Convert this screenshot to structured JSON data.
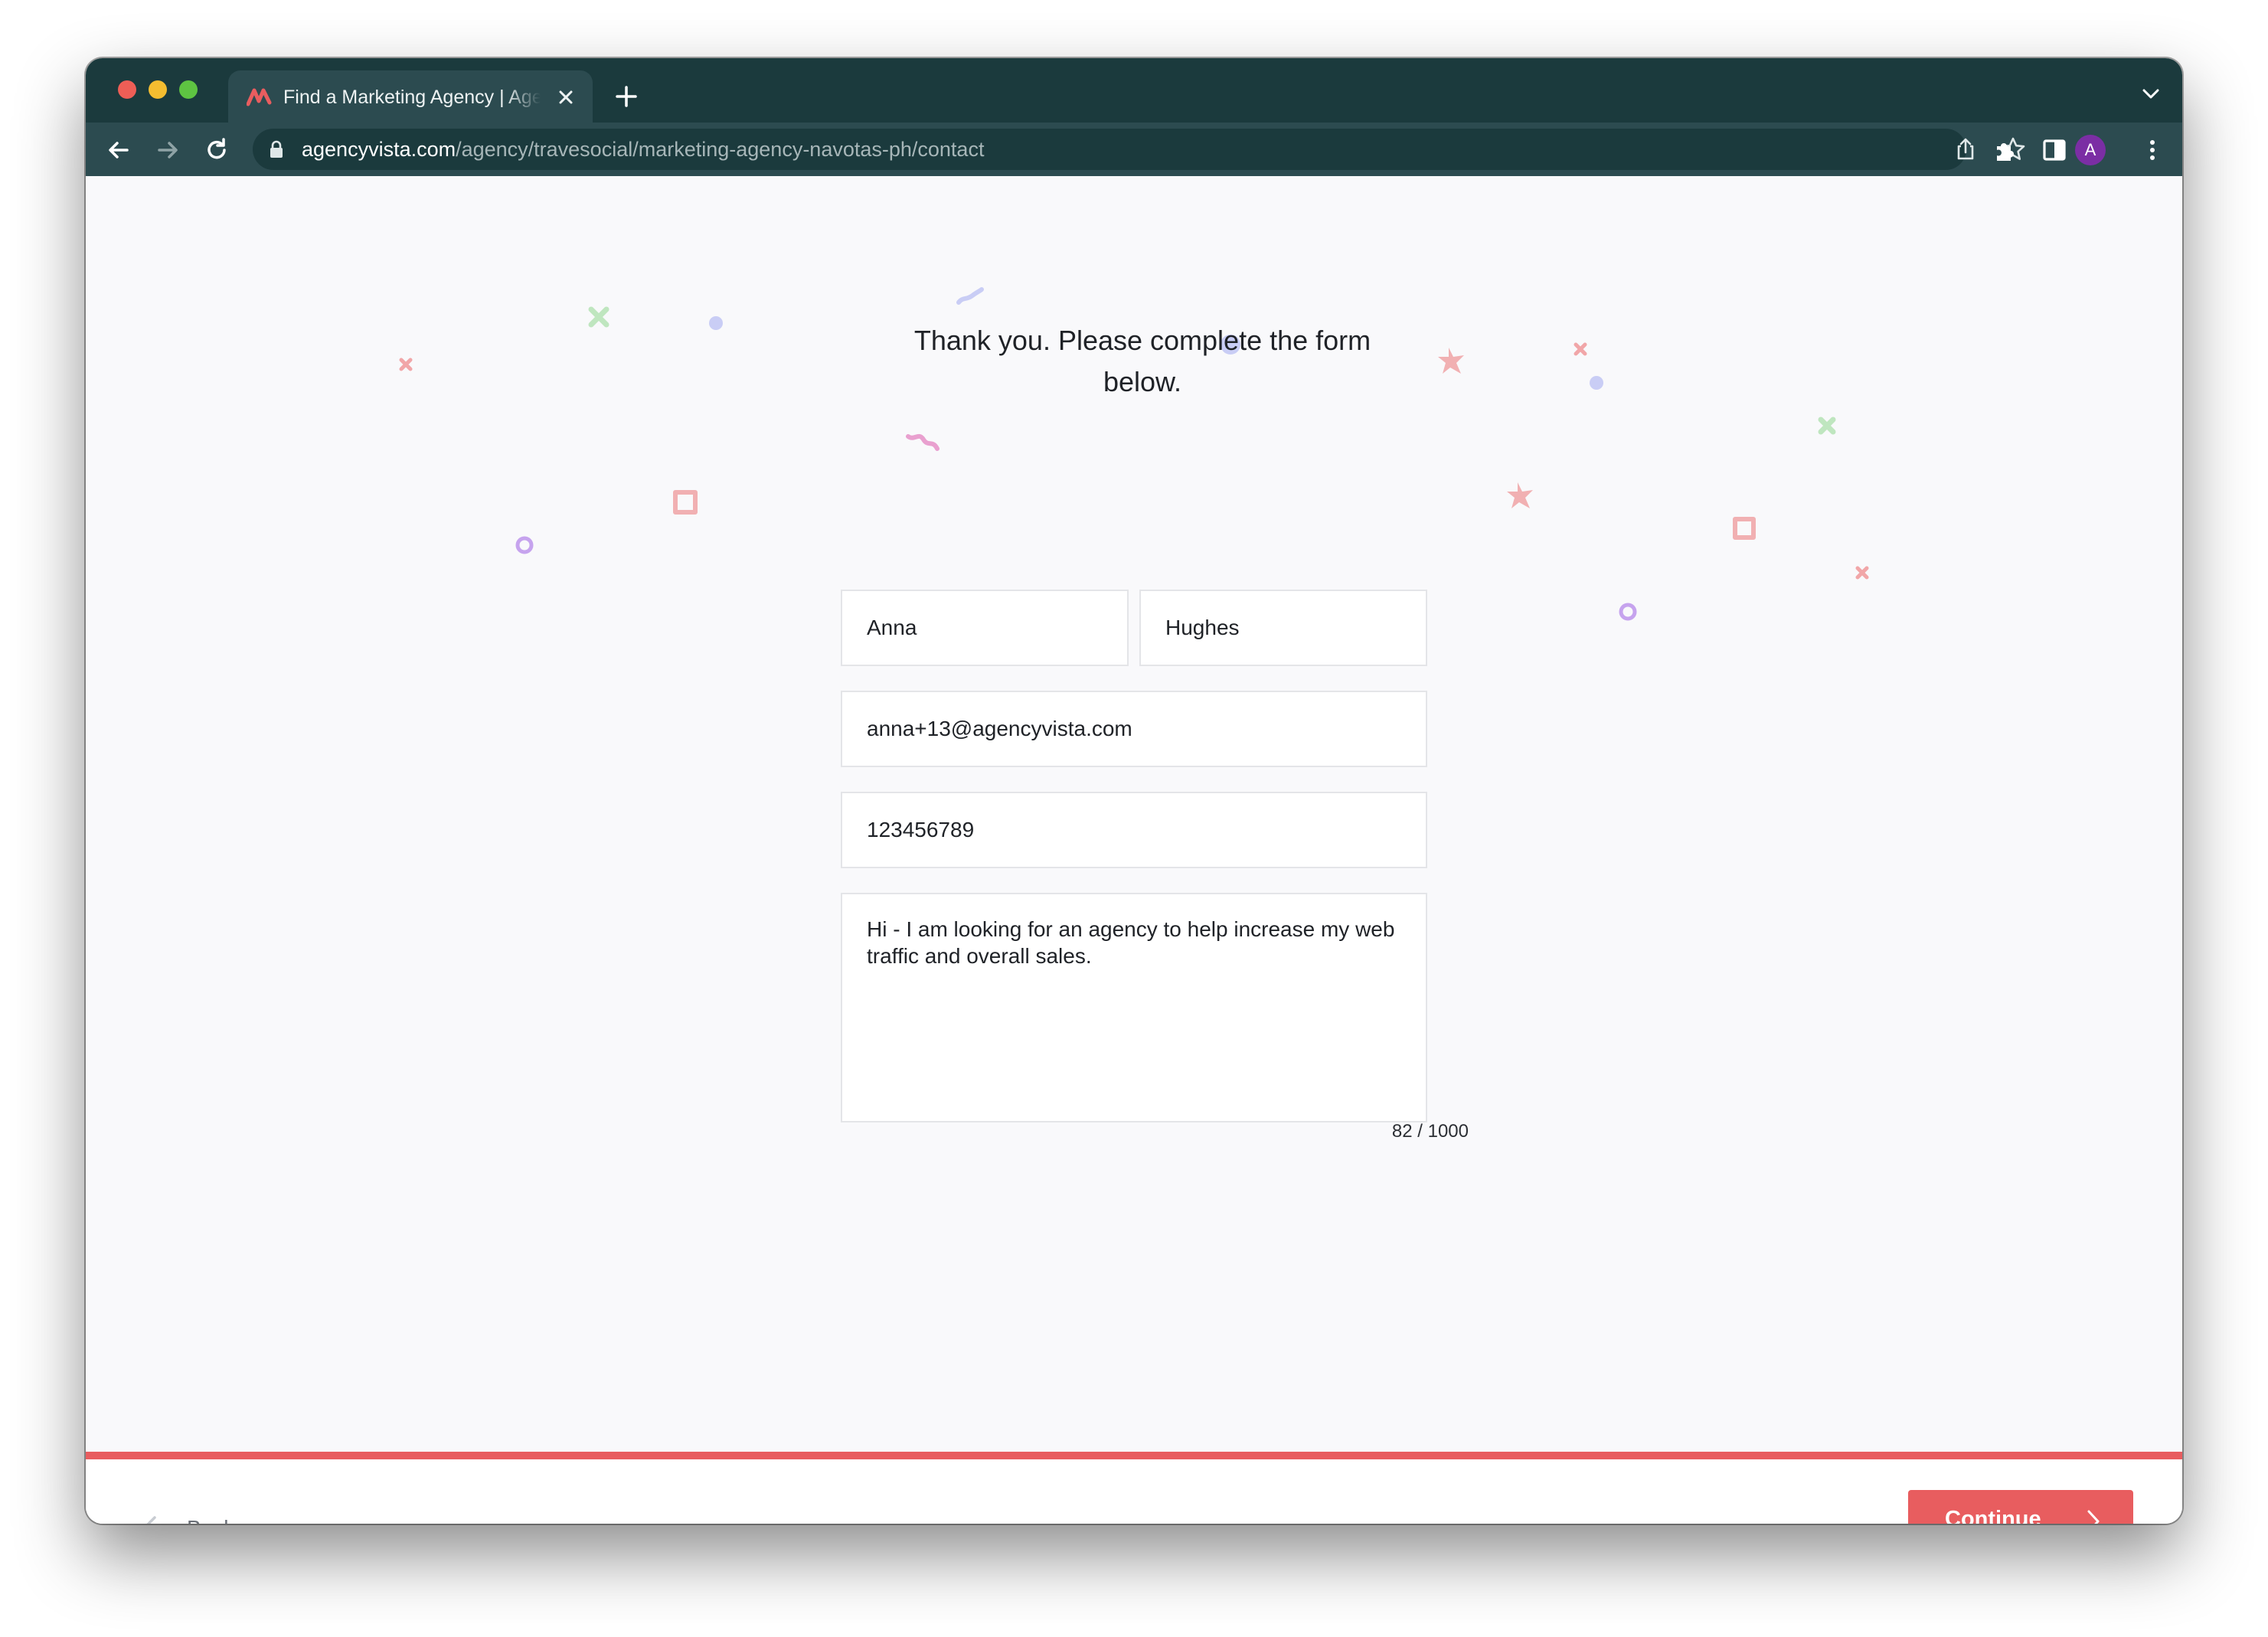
{
  "browser": {
    "tab_title": "Find a Marketing Agency | Agency Vista",
    "url_host": "agencyvista.com",
    "url_path": "/agency/travesocial/marketing-agency-navotas-ph/contact",
    "profile_initial": "A"
  },
  "page": {
    "heading_line1": "Thank you. Please complete the form",
    "heading_line2": "below."
  },
  "form": {
    "first_name": "Anna",
    "last_name": "Hughes",
    "email": "anna+13@agencyvista.com",
    "phone": "123456789",
    "message": "Hi - I am looking for an agency to help increase my web traffic and overall sales.",
    "char_count": "82 / 1000"
  },
  "progress": {
    "fraction": 1.0
  },
  "footer": {
    "back_label": "Back",
    "continue_label": "Continue"
  },
  "colors": {
    "browser_dark": "#1b3a3d",
    "browser_toolbar": "#2c4b50",
    "accent": "#e85d5f",
    "page_bg": "#f9f9fb"
  },
  "icons": [
    "favicon-icon",
    "close-icon",
    "plus-icon",
    "chevron-down-icon",
    "back-arrow-icon",
    "forward-arrow-icon",
    "reload-icon",
    "lock-icon",
    "share-icon",
    "star-icon",
    "extensions-icon",
    "side-panel-icon",
    "menu-icon",
    "chevron-left-icon",
    "chevron-right-icon"
  ]
}
